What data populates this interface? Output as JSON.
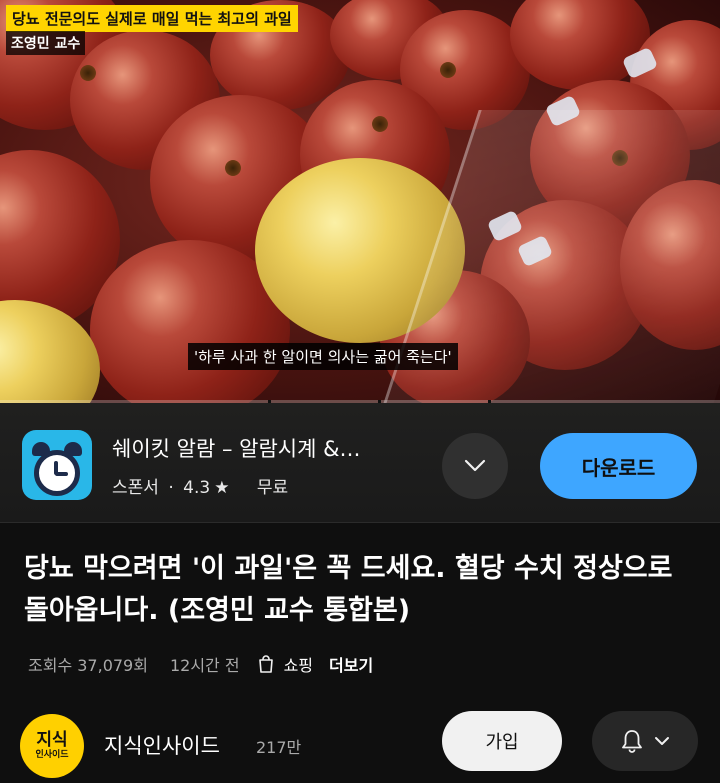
{
  "video": {
    "overlay_title": "당뇨 전문의도 실제로 매일 먹는 최고의 과일",
    "overlay_name": "조영민 교수",
    "caption": "'하루 사과 한 알이면 의사는 굶어 죽는다'"
  },
  "ad": {
    "app_name": "쉐이킷 알람 – 알람시계 &…",
    "sponsored": "스폰서",
    "separator": "·",
    "rating": "4.3",
    "star": "★",
    "price": "무료",
    "download": "다운로드",
    "accent_color": "#3ea6ff",
    "icon_bg": "#29b7e8"
  },
  "video_info": {
    "title": "당뇨 막으려면 '이 과일'은 꼭 드세요. 혈당 수치 정상으로 돌아옵니다. (조영민 교수 통합본)",
    "views": "조회수 37,079회",
    "time_ago": "12시간 전",
    "shopping": "쇼핑",
    "more": "더보기"
  },
  "channel": {
    "avatar_line1": "지식",
    "avatar_line2": "인사이드",
    "name": "지식인사이드",
    "subscribers": "217만",
    "join": "가입",
    "avatar_color": "#ffd000"
  },
  "icons": [
    "chevron-down-icon",
    "shopping-bag-icon",
    "bell-icon",
    "alarm-clock-icon"
  ]
}
